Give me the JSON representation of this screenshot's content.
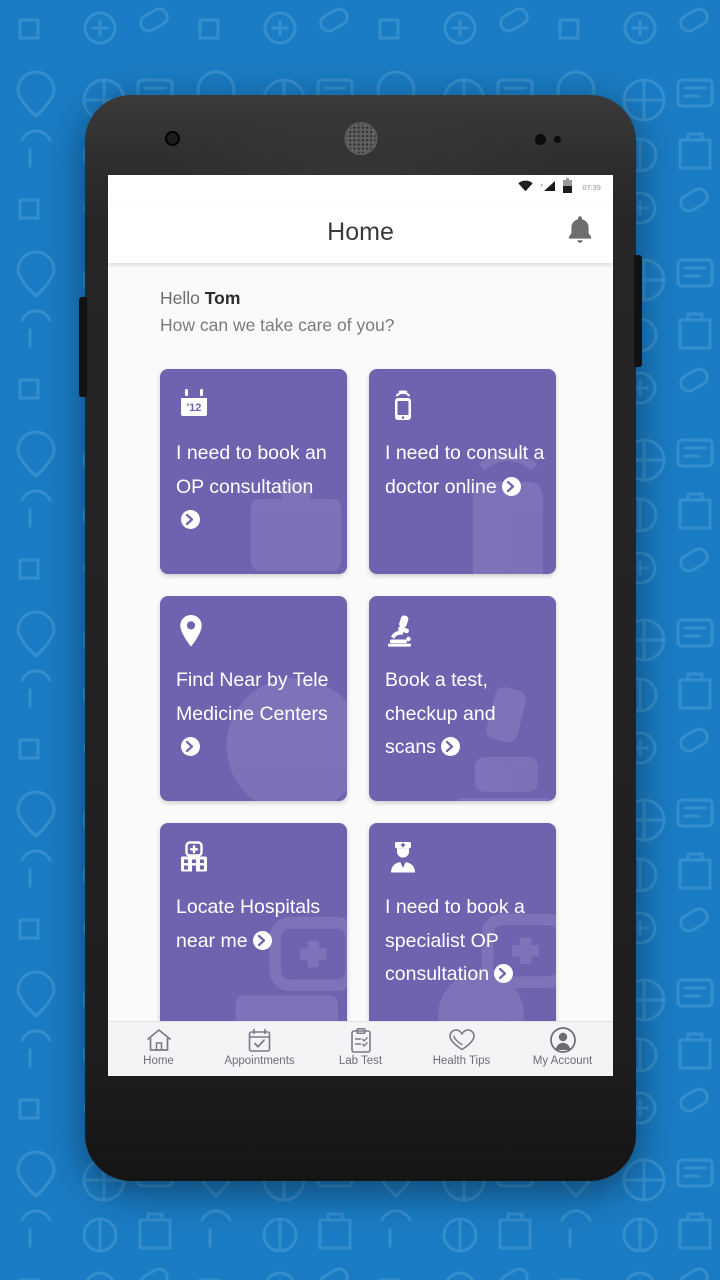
{
  "background": {
    "color": "#1a7cc4",
    "pattern_name": "medical-icons-pattern"
  },
  "device": {
    "frame_color": "#262626",
    "camera_icon": "front-camera-icon",
    "speaker_icon": "earpiece-speaker-icon",
    "sensor_icon": "proximity-sensor-icon",
    "volume_button": "volume-rocker",
    "power_button": "power-button"
  },
  "statusbar": {
    "wifi_icon": "wifi-icon",
    "signal_icon": "cellular-signal-icon",
    "battery_icon": "battery-icon",
    "time": "07:39"
  },
  "appbar": {
    "title": "Home",
    "notification_icon": "bell-icon"
  },
  "greeting": {
    "hello_prefix": "Hello ",
    "user_name": "Tom",
    "question": "How can we take care of you?"
  },
  "theme": {
    "card_color": "#6f63b0",
    "screen_bg": "#fafafa",
    "appbar_bg": "#ffffff",
    "nav_bg": "#f4f4f6"
  },
  "cards": [
    {
      "label": "I need to book an OP consultation",
      "icon": "calendar-icon",
      "badge": "'12",
      "ghost": "briefcase-ghost"
    },
    {
      "label": "I need to consult a doctor online",
      "icon": "mobile-signal-icon",
      "ghost": "phone-ghost"
    },
    {
      "label": "Find Near by Tele Medicine Centers",
      "icon": "map-pin-icon",
      "ghost": "pin-ghost"
    },
    {
      "label": "Book a test, checkup and scans",
      "icon": "microscope-icon",
      "ghost": "microscope-ghost"
    },
    {
      "label": "Locate Hospitals near me",
      "icon": "hospital-icon",
      "ghost": "hospital-ghost"
    },
    {
      "label": "I need to book a specialist OP consultation",
      "icon": "doctor-icon",
      "ghost": "doctor-ghost"
    }
  ],
  "bottom_nav": {
    "active_index": 0,
    "items": [
      {
        "label": "Home",
        "icon": "home-icon"
      },
      {
        "label": "Appointments",
        "icon": "calendar-check-icon"
      },
      {
        "label": "Lab Test",
        "icon": "clipboard-icon"
      },
      {
        "label": "Health Tips",
        "icon": "heart-icon"
      },
      {
        "label": "My Account",
        "icon": "user-circle-icon"
      }
    ]
  }
}
